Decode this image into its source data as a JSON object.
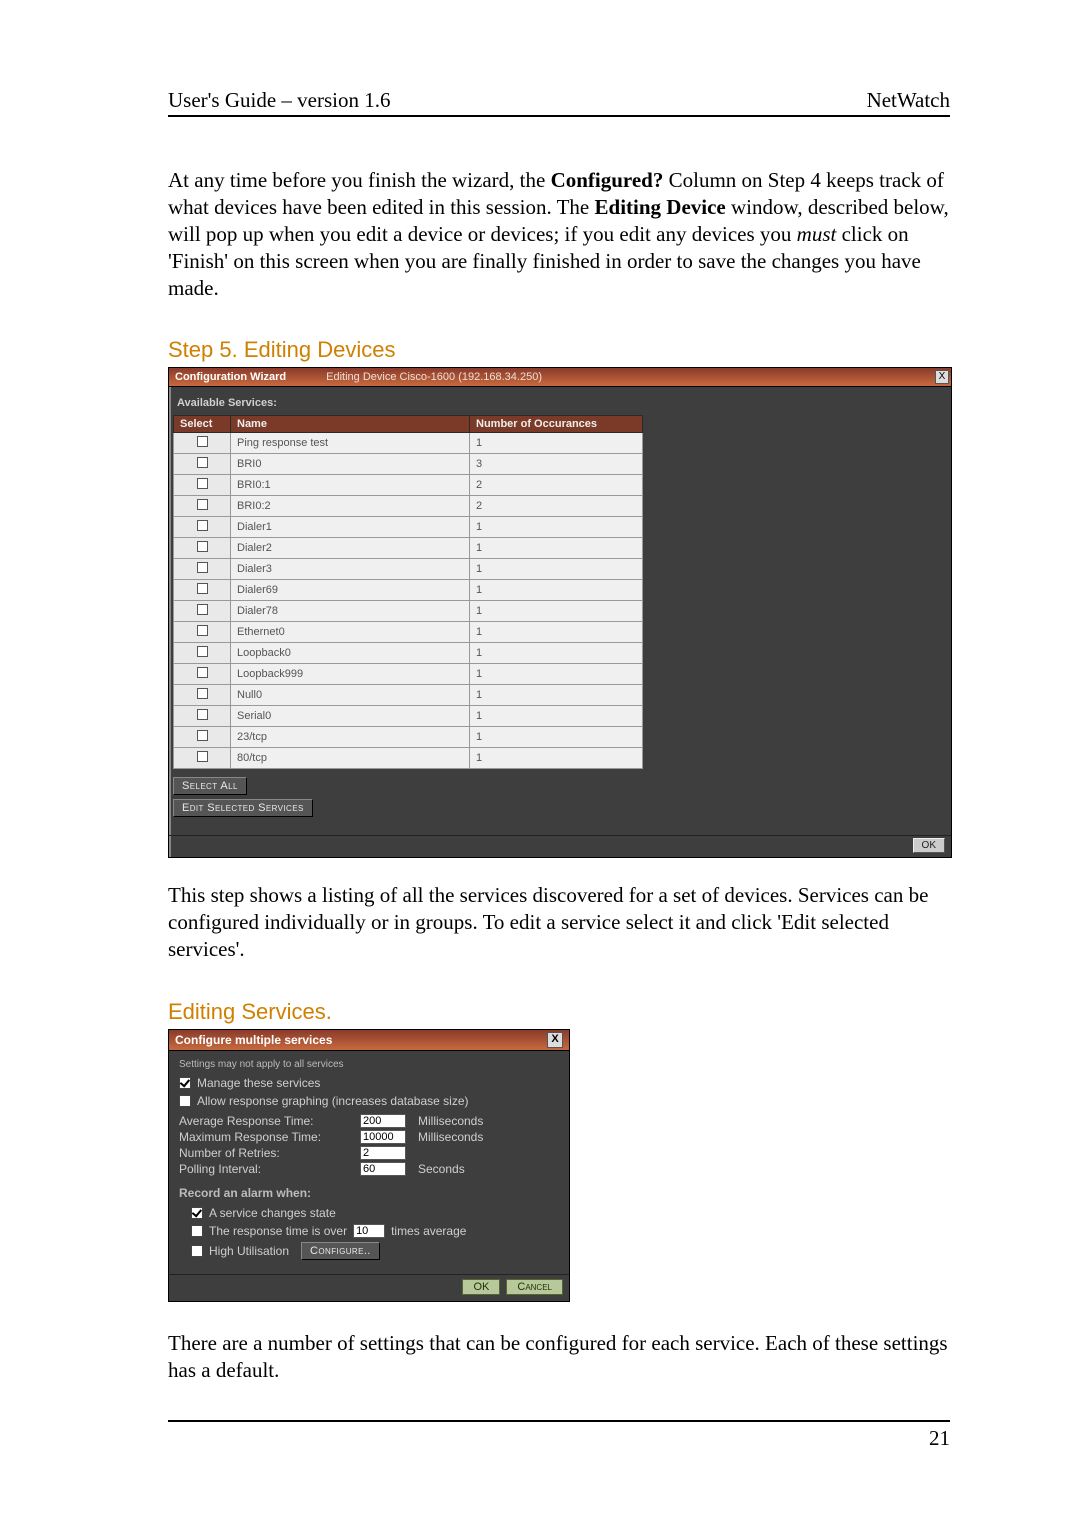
{
  "header": {
    "left": "User's Guide – version 1.6",
    "right": "NetWatch"
  },
  "para1_pre": "At any time before you finish the wizard, the ",
  "para1_b1": "Configured?",
  "para1_mid1": " Column on Step 4 keeps track of what devices have been edited in this session. The ",
  "para1_b2": "Editing Device",
  "para1_mid2": " window, described below, will pop up when you edit a device or devices; if you edit any devices you ",
  "para1_i": "must",
  "para1_end": " click on 'Finish' on this screen when you are finally finished in order to save the changes you have made.",
  "step5_heading": "Step 5. Editing Devices",
  "wizard": {
    "title_left": "Configuration Wizard",
    "title_mid": "Editing Device Cisco-1600 (192.168.34.250)",
    "close_x": "X",
    "available_label": "Available Services:",
    "columns": {
      "select": "Select",
      "name": "Name",
      "occur": "Number of Occurances"
    },
    "rows": [
      {
        "name": "Ping response test",
        "occ": "1"
      },
      {
        "name": "BRI0",
        "occ": "3"
      },
      {
        "name": "BRI0:1",
        "occ": "2"
      },
      {
        "name": "BRI0:2",
        "occ": "2"
      },
      {
        "name": "Dialer1",
        "occ": "1"
      },
      {
        "name": "Dialer2",
        "occ": "1"
      },
      {
        "name": "Dialer3",
        "occ": "1"
      },
      {
        "name": "Dialer69",
        "occ": "1"
      },
      {
        "name": "Dialer78",
        "occ": "1"
      },
      {
        "name": "Ethernet0",
        "occ": "1"
      },
      {
        "name": "Loopback0",
        "occ": "1"
      },
      {
        "name": "Loopback999",
        "occ": "1"
      },
      {
        "name": "Null0",
        "occ": "1"
      },
      {
        "name": "Serial0",
        "occ": "1"
      },
      {
        "name": "23/tcp",
        "occ": "1"
      },
      {
        "name": "80/tcp",
        "occ": "1"
      }
    ],
    "select_all": "Select All",
    "edit_selected": "Edit Selected Services",
    "ok": "OK"
  },
  "para2": "This step shows a listing of all the services discovered for a set of devices. Services can be configured individually or in groups. To edit a service select it and click 'Edit selected services'.",
  "editing_heading": "Editing Services.",
  "svc": {
    "title": "Configure multiple services",
    "close_x": "X",
    "note": "Settings may not apply to all services",
    "cb_manage": {
      "label": "Manage these services",
      "checked": true
    },
    "cb_graph": {
      "label": "Allow response graphing (increases database size)",
      "checked": false
    },
    "avg_label": "Average Response Time:",
    "avg_value": "200",
    "avg_unit": "Milliseconds",
    "max_label": "Maximum Response Time:",
    "max_value": "10000",
    "max_unit": "Milliseconds",
    "retries_label": "Number of Retries:",
    "retries_value": "2",
    "retries_unit": "",
    "poll_label": "Polling Interval:",
    "poll_value": "60",
    "poll_unit": "Seconds",
    "record_heading": "Record an alarm when:",
    "cb_state": {
      "label": "A service changes state",
      "checked": true
    },
    "cb_resp_pre": "The response time is over",
    "cb_resp_value": "10",
    "cb_resp_post": " times average",
    "cb_resp_checked": false,
    "cb_high_label": "High Utilisation",
    "cb_high_checked": false,
    "configure_btn": "Configure..",
    "ok": "OK",
    "cancel": "Cancel"
  },
  "para3": "There are a number of settings that can be configured for each service. Each of these settings has a default.",
  "pagenum": "21"
}
